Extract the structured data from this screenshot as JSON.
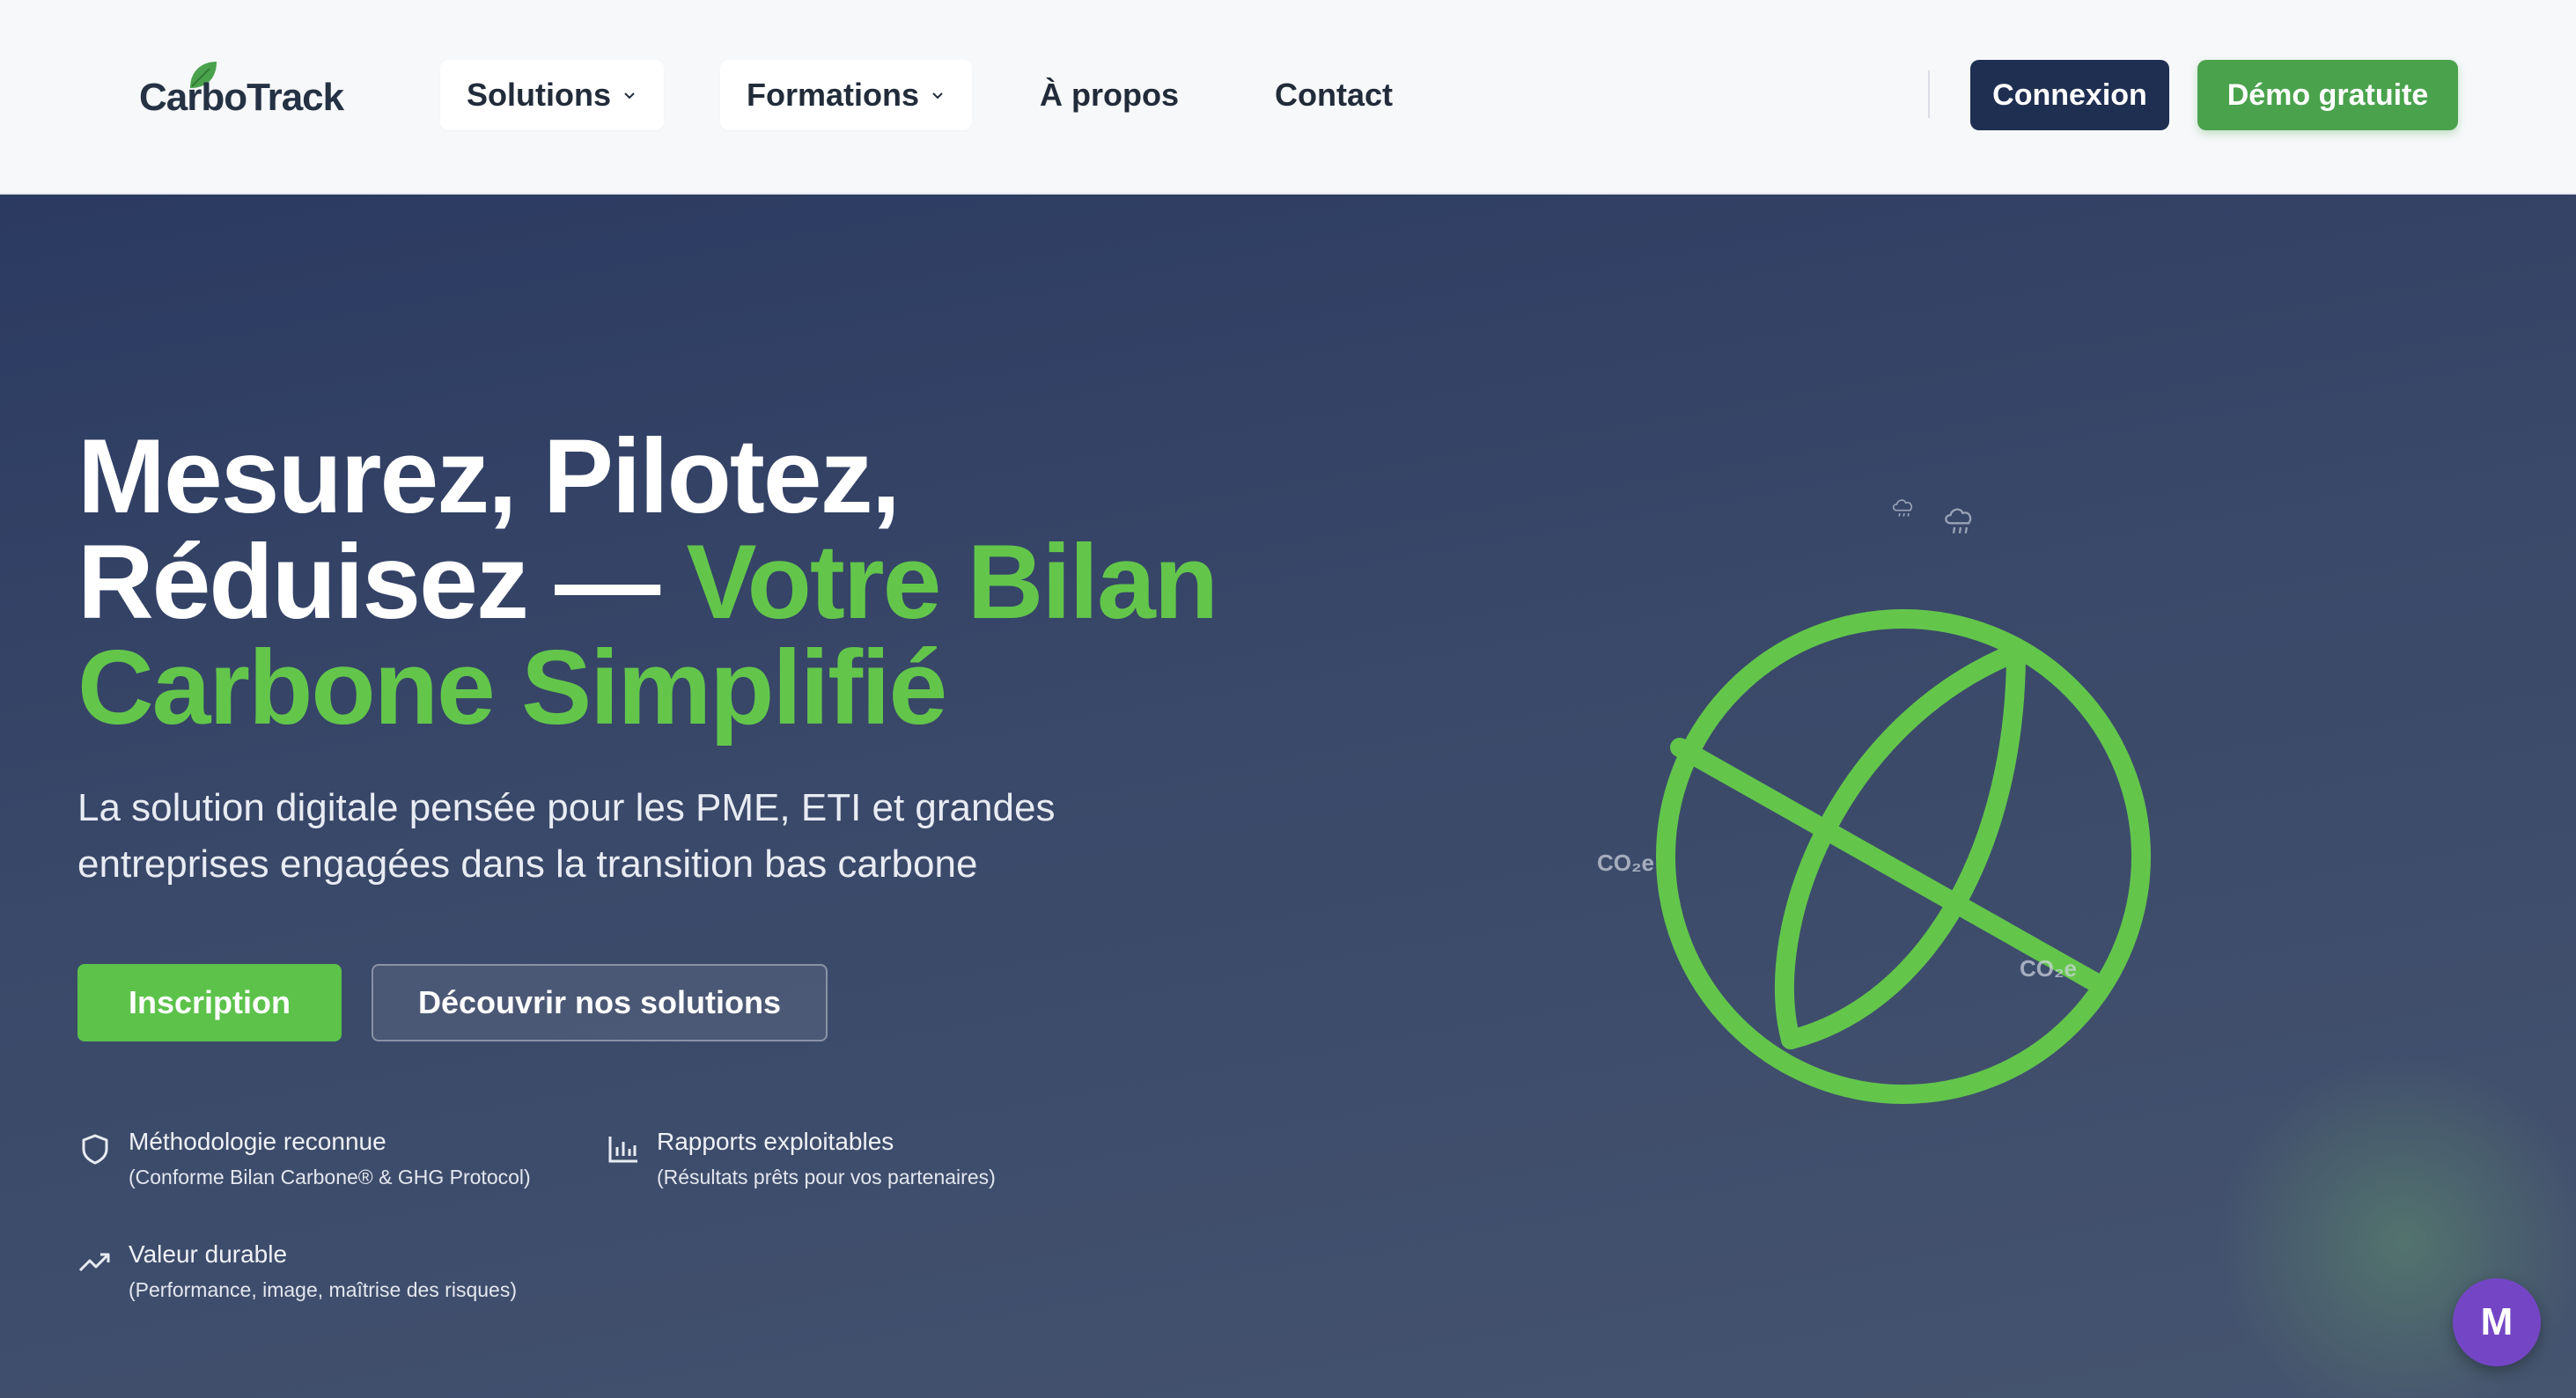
{
  "brand": {
    "name": "CarboTrack",
    "leaf_color": "#4aa24d"
  },
  "nav": {
    "items": [
      {
        "label": "Solutions",
        "dropdown": true
      },
      {
        "label": "Formations",
        "dropdown": true
      },
      {
        "label": "À propos",
        "dropdown": false
      },
      {
        "label": "Contact",
        "dropdown": false
      }
    ],
    "login_label": "Connexion",
    "demo_label": "Démo gratuite"
  },
  "hero": {
    "headline_line1": "Mesurez, Pilotez,",
    "headline_line2_white": "Réduisez — ",
    "headline_line2_green": "Votre Bilan",
    "headline_line3_green": "Carbone Simplifié",
    "subtitle_line1": "La solution digitale pensée pour les PME, ETI et grandes",
    "subtitle_line2": "entreprises engagées dans la transition bas carbone",
    "primary_cta": "Inscription",
    "secondary_cta": "Découvrir nos solutions",
    "features": [
      {
        "icon": "shield-icon",
        "title": "Méthodologie reconnue",
        "subtitle": "(Conforme Bilan Carbone® & GHG Protocol)"
      },
      {
        "icon": "bar-chart-icon",
        "title": "Rapports exploitables",
        "subtitle": "(Résultats prêts pour vos partenaires)"
      },
      {
        "icon": "trending-up-icon",
        "title": "Valeur durable",
        "subtitle": "(Performance, image, maîtrise des risques)"
      }
    ],
    "illustration": {
      "label_left": "CO₂e",
      "label_right": "CO₂e",
      "globe_color": "#63c64b"
    }
  },
  "assistant": {
    "initial": "M",
    "color": "#7446c5"
  },
  "colors": {
    "navy": "#1f2f52",
    "green": "#4aa24d",
    "accent_green": "#5cc24a"
  }
}
